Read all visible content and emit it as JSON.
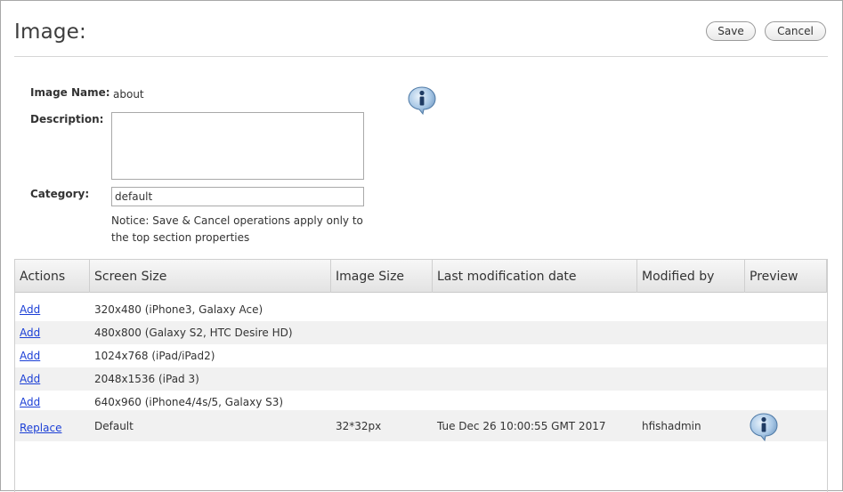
{
  "header": {
    "title": "Image:",
    "save_label": "Save",
    "cancel_label": "Cancel"
  },
  "form": {
    "name_label": "Image Name:",
    "name_value": "about",
    "description_label": "Description:",
    "description_value": "",
    "category_label": "Category:",
    "category_value": "default",
    "notice": "Notice: Save & Cancel operations apply only to the top section properties"
  },
  "table": {
    "columns": [
      "Actions",
      "Screen Size",
      "Image Size",
      "Last modification date",
      "Modified by",
      "Preview"
    ],
    "rows": [
      {
        "action": "Add",
        "screen_size": "320x480 (iPhone3, Galaxy Ace)",
        "image_size": "",
        "modified": "",
        "modified_by": ""
      },
      {
        "action": "Add",
        "screen_size": "480x800 (Galaxy S2, HTC Desire HD)",
        "image_size": "",
        "modified": "",
        "modified_by": ""
      },
      {
        "action": "Add",
        "screen_size": "1024x768 (iPad/iPad2)",
        "image_size": "",
        "modified": "",
        "modified_by": ""
      },
      {
        "action": "Add",
        "screen_size": "2048x1536 (iPad 3)",
        "image_size": "",
        "modified": "",
        "modified_by": ""
      },
      {
        "action": "Add",
        "screen_size": "640x960 (iPhone4/4s/5, Galaxy S3)",
        "image_size": "",
        "modified": "",
        "modified_by": ""
      },
      {
        "action": "Replace",
        "screen_size": "Default",
        "image_size": "32*32px",
        "modified": "Tue Dec 26 10:00:55 GMT 2017",
        "modified_by": "hfishadmin"
      }
    ]
  },
  "icons": {
    "info": "info-speech-bubble-icon"
  },
  "colors": {
    "link": "#1b3fd6",
    "alt_row": "#f1f1f1",
    "info_icon": "#2f6fa8"
  }
}
